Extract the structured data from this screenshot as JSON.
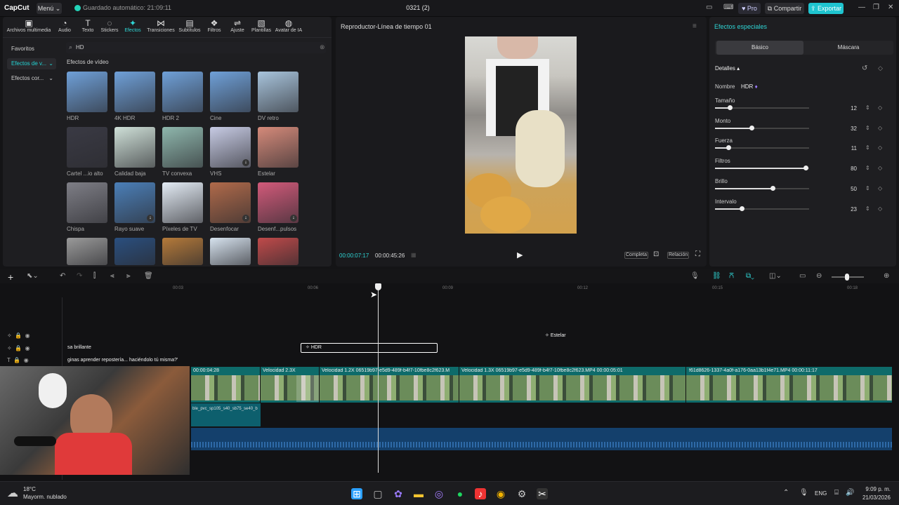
{
  "titlebar": {
    "logo": "CapCut",
    "menu": "Menú",
    "autosave": "Guardado automático: 21:09:11",
    "project": "0321 (2)",
    "pro": "Pro",
    "share": "Compartir",
    "export": "Exportar"
  },
  "tabs": [
    {
      "label": "Archivos multimedia",
      "icon": "media-icon"
    },
    {
      "label": "Audio",
      "icon": "audio-icon"
    },
    {
      "label": "Texto",
      "icon": "text-icon"
    },
    {
      "label": "Stickers",
      "icon": "sticker-icon"
    },
    {
      "label": "Efectos",
      "icon": "effects-icon"
    },
    {
      "label": "Transiciones",
      "icon": "transition-icon"
    },
    {
      "label": "Subtítulos",
      "icon": "subtitle-icon"
    },
    {
      "label": "Filtros",
      "icon": "filter-icon"
    },
    {
      "label": "Ajuste",
      "icon": "adjust-icon"
    },
    {
      "label": "Plantillas",
      "icon": "template-icon"
    },
    {
      "label": "Avatar de IA",
      "icon": "avatar-icon"
    }
  ],
  "categories": [
    "Favoritos",
    "Efectos de v...",
    "Efectos cor..."
  ],
  "search": {
    "value": "HD"
  },
  "effects_title": "Efectos de vídeo",
  "effects": [
    {
      "label": "HDR",
      "color": "#6fa0d8"
    },
    {
      "label": "4K HDR",
      "color": "#6fa0d8"
    },
    {
      "label": "HDR 2",
      "color": "#6fa0d8"
    },
    {
      "label": "Cine",
      "color": "#6fa0d8"
    },
    {
      "label": "DV retro",
      "color": "#a8c4dc"
    },
    {
      "label": "Cartel ...io alto",
      "color": "#3a3a44"
    },
    {
      "label": "Calidad baja",
      "color": "#cfe0d8"
    },
    {
      "label": "TV convexa",
      "color": "#8fb7ad"
    },
    {
      "label": "VHS",
      "color": "#c7cbe4"
    },
    {
      "label": "Estelar",
      "color": "#d58a7a"
    },
    {
      "label": "Chispa",
      "color": "#7e7e86"
    },
    {
      "label": "Rayo suave",
      "color": "#4b7fb8"
    },
    {
      "label": "Píxeles de TV",
      "color": "#e4ecf5"
    },
    {
      "label": "Desenfocar",
      "color": "#b06a4a"
    },
    {
      "label": "Desenf...pulsos",
      "color": "#d25a7a"
    },
    {
      "label": "",
      "color": "#9a9a9a"
    },
    {
      "label": "",
      "color": "#2a4f7f"
    },
    {
      "label": "",
      "color": "#b57a3a"
    },
    {
      "label": "",
      "color": "#d7e3ef"
    },
    {
      "label": "",
      "color": "#c04a4a"
    }
  ],
  "player": {
    "title": "Reproductor-Línea de tiempo 01",
    "current": "00:00:07:17",
    "total": "00:00:45:26",
    "full": "Completa",
    "ratio": "Relación"
  },
  "props": {
    "title": "Efectos especiales",
    "tab_basic": "Básico",
    "tab_mask": "Máscara",
    "details": "Detalles",
    "name_label": "Nombre",
    "name_value": "HDR",
    "sliders": [
      {
        "label": "Tamaño",
        "value": "12",
        "level": 0.16
      },
      {
        "label": "Monto",
        "value": "32",
        "level": 0.39
      },
      {
        "label": "Fuerza",
        "value": "11",
        "level": 0.14
      },
      {
        "label": "Filtros",
        "value": "80",
        "level": 0.96
      },
      {
        "label": "Brillo",
        "value": "50",
        "level": 0.61
      },
      {
        "label": "Intervalo",
        "value": "23",
        "level": 0.28
      }
    ]
  },
  "ruler": [
    "00:03",
    "00:06",
    "00:09",
    "00:12",
    "00:15",
    "00:18"
  ],
  "timeline": {
    "effect_clips": [
      {
        "label": "Estelar",
        "color": "#8c4ea0"
      },
      {
        "label": "sa brillante",
        "color": "#8c4ea0"
      },
      {
        "label": "HDR",
        "color": "#8c4ea0"
      },
      {
        "label": "ginas aprender repostería... haciéndolo tú misma?'",
        "color": "#b54a3a"
      }
    ],
    "video_labels": [
      "00:00:04:28",
      "Velocidad 2.3X",
      "Velocidad 1.2X  06519b97-e5d9-489f-b4f7-10fbe8c2f623.M",
      "Velocidad 1.3X  06519b97-e5d9-489f-b4f7-10fbe8c2f623.MP4  00:00:05:01",
      "f61d8626-1337-4a0f-a176-0aa13b1f4e71.MP4  00:00:11:17"
    ],
    "audio_label": "ble_pvc_sp105_s40_sb75_se40_b"
  },
  "taskbar": {
    "weather_temp": "18°C",
    "weather_desc": "Mayorm. nublado",
    "lang": "ENG",
    "time": "9:09 p. m.",
    "date": "21/03/2026"
  }
}
